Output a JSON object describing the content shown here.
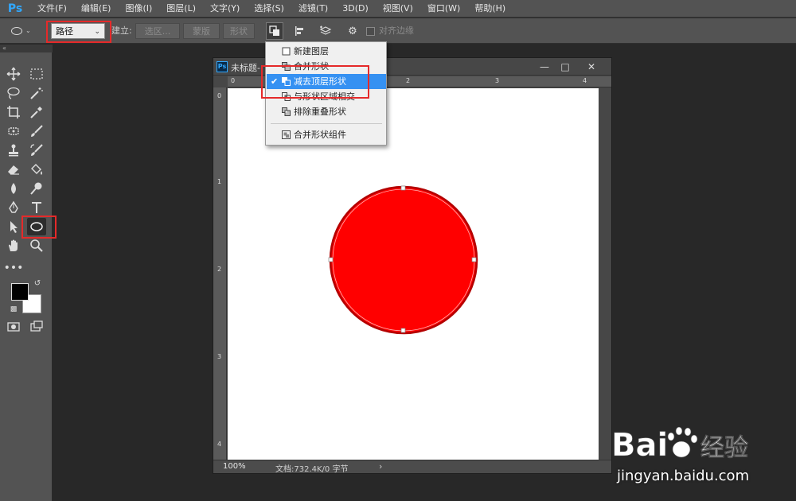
{
  "app": {
    "logo": "Ps"
  },
  "menubar": {
    "items": [
      "文件(F)",
      "编辑(E)",
      "图像(I)",
      "图层(L)",
      "文字(Y)",
      "选择(S)",
      "滤镜(T)",
      "3D(D)",
      "视图(V)",
      "窗口(W)",
      "帮助(H)"
    ]
  },
  "options": {
    "mode_value": "路径",
    "build_label": "建立:",
    "selection_btn": "选区...",
    "mask_btn": "蒙版",
    "shape_btn": "形状",
    "align_edges_label": "对齐边缘",
    "align_edges_checked": false
  },
  "path_ops_menu": {
    "items": [
      {
        "label": "新建图层",
        "icon": "new-layer-icon",
        "checked": false,
        "selected": false
      },
      {
        "label": "合并形状",
        "icon": "combine-shapes-icon",
        "checked": false,
        "selected": false
      },
      {
        "label": "减去顶层形状",
        "icon": "subtract-front-shape-icon",
        "checked": true,
        "selected": true
      },
      {
        "label": "与形状区域相交",
        "icon": "intersect-shapes-icon",
        "checked": false,
        "selected": false
      },
      {
        "label": "排除重叠形状",
        "icon": "exclude-overlap-icon",
        "checked": false,
        "selected": false
      },
      {
        "label": "合并形状组件",
        "icon": "merge-components-icon",
        "checked": false,
        "selected": false
      }
    ]
  },
  "document": {
    "title": "未标题-",
    "zoom": "100%",
    "info": "文档:732.4K/0 字节",
    "ruler_top_labels": [
      "0",
      "1",
      "2",
      "3",
      "4"
    ],
    "ruler_left_labels": [
      "0",
      "1",
      "2",
      "3",
      "4"
    ],
    "shape_fill": "#ff0000"
  },
  "tools": {
    "foreground_color": "#000000",
    "background_color": "#ffffff",
    "active_tool": "ellipse-tool"
  },
  "watermark": {
    "brand": "Bai",
    "brand2": "du",
    "brand_cn": "经验",
    "url": "jingyan.baidu.com"
  },
  "colors": {
    "accent": "#31a8ff",
    "highlight": "#e52a2a",
    "menu_selected": "#3591f2"
  }
}
